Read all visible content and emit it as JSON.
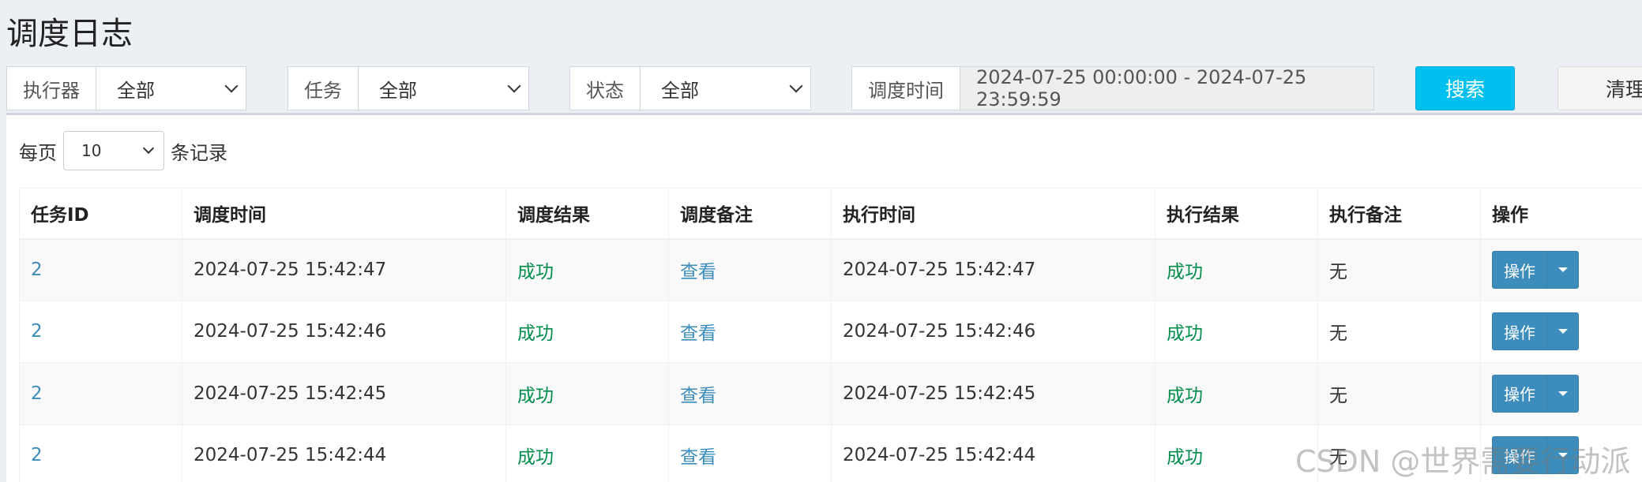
{
  "page": {
    "title": "调度日志"
  },
  "filters": {
    "executor": {
      "label": "执行器",
      "value": "全部"
    },
    "task": {
      "label": "任务",
      "value": "全部"
    },
    "status": {
      "label": "状态",
      "value": "全部"
    },
    "time": {
      "label": "调度时间",
      "value": "2024-07-25 00:00:00 - 2024-07-25 23:59:59"
    },
    "search_label": "搜索",
    "clear_label": "清理"
  },
  "pagination": {
    "prefix": "每页",
    "value": "10",
    "suffix": "条记录"
  },
  "table": {
    "headers": [
      "任务ID",
      "调度时间",
      "调度结果",
      "调度备注",
      "执行时间",
      "执行结果",
      "执行备注",
      "操作"
    ],
    "rows": [
      {
        "id": "2",
        "trigger_time": "2024-07-25 15:42:47",
        "trigger_result": "成功",
        "trigger_msg": "查看",
        "handle_time": "2024-07-25 15:42:47",
        "handle_result": "成功",
        "handle_msg": "无",
        "op": "操作"
      },
      {
        "id": "2",
        "trigger_time": "2024-07-25 15:42:46",
        "trigger_result": "成功",
        "trigger_msg": "查看",
        "handle_time": "2024-07-25 15:42:46",
        "handle_result": "成功",
        "handle_msg": "无",
        "op": "操作"
      },
      {
        "id": "2",
        "trigger_time": "2024-07-25 15:42:45",
        "trigger_result": "成功",
        "trigger_msg": "查看",
        "handle_time": "2024-07-25 15:42:45",
        "handle_result": "成功",
        "handle_msg": "无",
        "op": "操作"
      },
      {
        "id": "2",
        "trigger_time": "2024-07-25 15:42:44",
        "trigger_result": "成功",
        "trigger_msg": "查看",
        "handle_time": "2024-07-25 15:42:44",
        "handle_result": "成功",
        "handle_msg": "无",
        "op": "操作"
      }
    ]
  },
  "watermark": "CSDN @世界需要行动派",
  "colors": {
    "primary": "#3c8dbc",
    "info": "#00c0ef",
    "success": "#008d4c",
    "background": "#ecf0f5"
  }
}
